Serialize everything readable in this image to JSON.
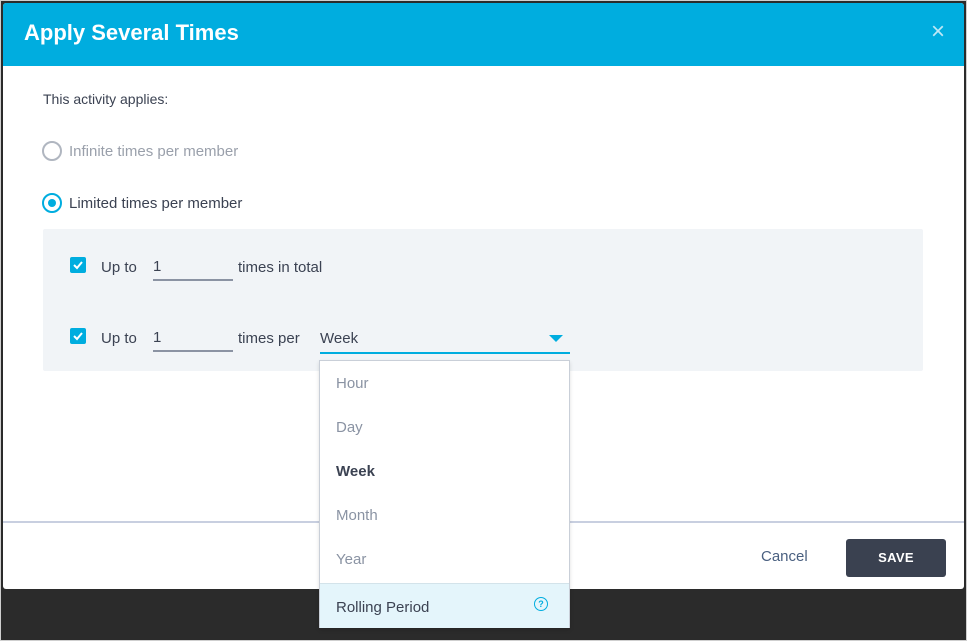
{
  "dialog": {
    "title": "Apply Several Times",
    "close_icon": "×"
  },
  "applies_label": "This activity applies:",
  "options": {
    "infinite": {
      "label": "Infinite times per member",
      "selected": false
    },
    "limited": {
      "label": "Limited times per member",
      "selected": true
    }
  },
  "limits": {
    "total": {
      "checked": true,
      "prefix": "Up to",
      "value": "1",
      "suffix": "times in total"
    },
    "period": {
      "checked": true,
      "prefix": "Up to",
      "value": "1",
      "suffix": "times per",
      "selected_period": "Week"
    }
  },
  "dropdown": {
    "items": [
      "Hour",
      "Day",
      "Week",
      "Month",
      "Year"
    ],
    "selected": "Week",
    "rolling": {
      "label": "Rolling Period",
      "icon": "?"
    }
  },
  "footer": {
    "cancel_label": "Cancel",
    "save_label": "SAVE"
  },
  "colors": {
    "header": "#00addf",
    "accent": "#00addf",
    "save_button": "#3a4150"
  }
}
